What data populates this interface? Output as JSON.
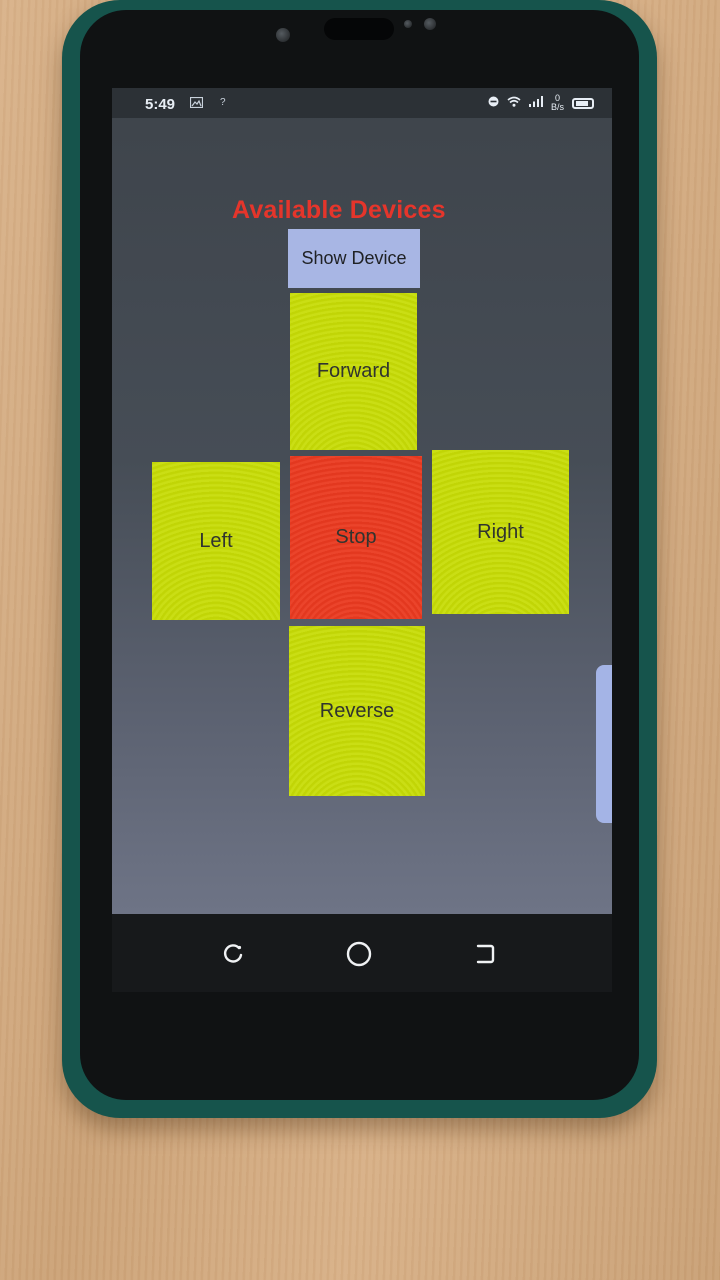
{
  "status_bar": {
    "time": "5:49",
    "unknown_icon": "?",
    "net_speed_value": "0",
    "net_speed_unit": "B/s",
    "icons": [
      "image-icon",
      "dnd-icon",
      "wifi-icon",
      "signal-icon",
      "battery-icon"
    ]
  },
  "app": {
    "title": "Available Devices",
    "show_device_label": "Show Device",
    "controls": {
      "forward": "Forward",
      "left": "Left",
      "stop": "Stop",
      "right": "Right",
      "reverse": "Reverse"
    }
  },
  "colors": {
    "title": "#e5352b",
    "button_blue": "#a8b6e4",
    "direction_yellow": "#c7dc06",
    "stop_red": "#ea3a20",
    "phone_case": "#16544c"
  },
  "navigation_bar": {
    "icons": [
      "recent-apps-icon",
      "home-icon",
      "back-icon"
    ]
  }
}
